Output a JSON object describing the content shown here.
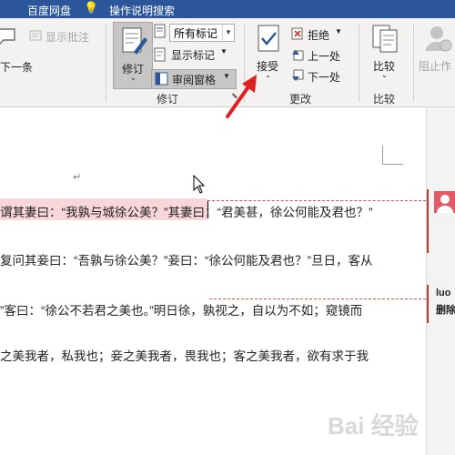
{
  "titlebar": {
    "app": "百度网盘",
    "search": "操作说明搜索",
    "bg": "#2b579a"
  },
  "ribbon": {
    "comments": {
      "show_comments": "显示批注",
      "next": "下一条"
    },
    "tracking": {
      "track_changes": "修订",
      "markup_select": "所有标记",
      "show_markup": "显示标记",
      "review_pane": "审阅窗格",
      "group_label": "修订"
    },
    "changes": {
      "accept": "接受",
      "reject": "拒绝",
      "previous": "上一处",
      "next": "下一处",
      "group_label": "更改"
    },
    "compare": {
      "button": "比较",
      "group_label": "比较"
    },
    "protect": {
      "block_authors": "阻止作"
    }
  },
  "document": {
    "paragraph_mark": "↵",
    "lines": [
      "谓其妻曰：“我孰与城徐公美？”其妻曰：“君美甚，徐公何能及君也？”",
      "复问其妾曰：“吾孰与徐公美？”妾曰：“徐公何能及君也？”旦日，客从",
      "”客曰：“徐公不若君之美也。”明日徐，孰视之，自以为不如；窥镜而",
      "之美我者，私我也；妾之美我者，畏我也；客之美我者，欲有求于我"
    ],
    "highlight_color": "#f8d7da"
  },
  "comment_pane": {
    "author": "luo",
    "action": "删除",
    "accent": "#c0392b"
  },
  "watermark": "Bai 经验"
}
